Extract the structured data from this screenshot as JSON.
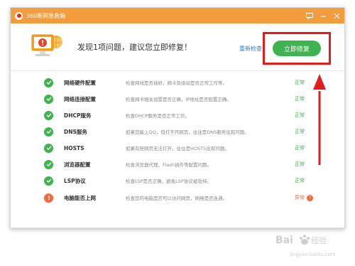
{
  "window": {
    "title": "360断网急救箱",
    "accent_color": "#f39c3d"
  },
  "banner": {
    "message": "发现1项问题，建议您立即修复！",
    "recheck_label": "重新检查",
    "fix_label": "立即修复"
  },
  "checks": [
    {
      "name": "网络硬件配置",
      "desc": "检查网线是否插好，网卡及驱动是否正常工作等。",
      "status": "正常",
      "state": "ok"
    },
    {
      "name": "网络连接配置",
      "desc": "检查网卡相关设置是否正确，IP地址是否配置正确。",
      "status": "正常",
      "state": "ok"
    },
    {
      "name": "DHCP服务",
      "desc": "检查DHCP服务是否正常工作。",
      "status": "正常",
      "state": "ok"
    },
    {
      "name": "DNS服务",
      "desc": "如果您能上QQ，但打不开网页，往往是DNS服务出现问题。",
      "status": "正常",
      "state": "ok"
    },
    {
      "name": "HOSTS",
      "desc": "如果有些网页无法打开，往往是HOSTS出现问题。",
      "status": "正常",
      "state": "ok"
    },
    {
      "name": "浏览器配置",
      "desc": "检查浏览器代理、Flash插件等配置问题。",
      "status": "正常",
      "state": "ok"
    },
    {
      "name": "LSP协议",
      "desc": "检查LSP是否正确，避免LSP协议被劫持。",
      "status": "正常",
      "state": "ok"
    },
    {
      "name": "电脑能否上网",
      "desc": "检查您的电脑是否可以访问网页，网络是否连通。",
      "status": "异常",
      "state": "err"
    }
  ],
  "colors": {
    "ok": "#3fb34f",
    "error": "#f0683c",
    "annotation": "#e21c1c"
  },
  "watermark": {
    "logo": "Bai百度 经验",
    "url": "jingyan.baidu.com"
  }
}
